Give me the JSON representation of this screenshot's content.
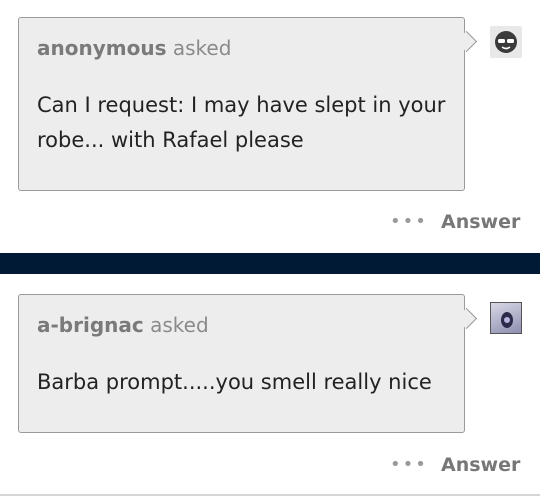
{
  "posts": [
    {
      "asker": "anonymous",
      "asked_word": "asked",
      "question": "Can I request: I may have slept in your robe... with Rafael please",
      "more_label": "•••",
      "answer_label": "Answer",
      "avatar_icon": "anonymous-sunglasses-avatar-icon"
    },
    {
      "asker": "a-brignac",
      "asked_word": "asked",
      "question": "Barba prompt.....you smell really nice",
      "more_label": "•••",
      "answer_label": "Answer",
      "avatar_icon": "user-avatar-image"
    }
  ],
  "colors": {
    "bubble_bg": "#ededed",
    "divider": "#001935",
    "text": "#222222",
    "muted": "#777777"
  }
}
